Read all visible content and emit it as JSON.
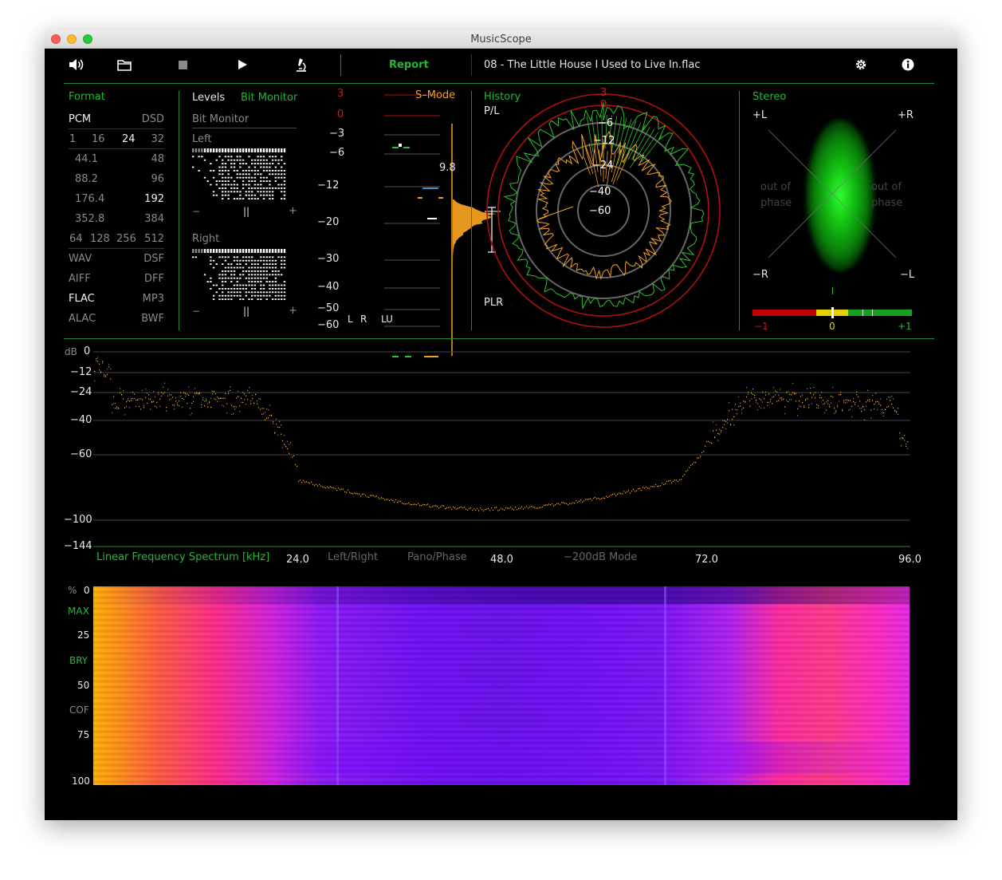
{
  "window": {
    "title": "MusicScope"
  },
  "toolbar": {
    "report_label": "Report",
    "track_title": "08 - The Little House I Used to Live In.flac"
  },
  "format": {
    "label": "Format",
    "rows": [
      [
        "PCM",
        "DSD"
      ],
      [
        "1",
        "16",
        "24",
        "32"
      ],
      [
        "44.1",
        "48"
      ],
      [
        "88.2",
        "96"
      ],
      [
        "176.4",
        "192"
      ],
      [
        "352.8",
        "384"
      ],
      [
        "64",
        "128",
        "256",
        "512"
      ],
      [
        "WAV",
        "DSF"
      ],
      [
        "AIFF",
        "DFF"
      ],
      [
        "FLAC",
        "MP3"
      ],
      [
        "ALAC",
        "BWF"
      ]
    ]
  },
  "levels": {
    "tab_levels": "Levels",
    "tab_bit_monitor": "Bit Monitor",
    "subtitle": "Bit Monitor",
    "left_label": "Left",
    "right_label": "Right",
    "minus": "−",
    "pause": "||",
    "plus": "+",
    "meter_ticks": [
      "3",
      "0",
      "−3",
      "−6",
      "−12",
      "−20",
      "−30",
      "−40",
      "−50",
      "−60"
    ],
    "channels": [
      "L",
      "R",
      "LU"
    ],
    "smode_label": "S–Mode",
    "loudness_value": "9.8"
  },
  "history": {
    "label": "History",
    "pl_label": "P/L",
    "plr_label": "PLR",
    "rings": [
      "3",
      "0",
      "−6",
      "−12",
      "−24",
      "−40",
      "−60"
    ]
  },
  "stereo": {
    "label": "Stereo",
    "plus_l": "+L",
    "plus_r": "+R",
    "minus_r": "−R",
    "minus_l": "−L",
    "out_of": "out of",
    "phase": "phase",
    "corr_min": "−1",
    "corr_mid": "0",
    "corr_max": "+1",
    "colors": {
      "red": "#c00000",
      "yellow": "#e6d100",
      "green": "#1aa020"
    }
  },
  "spectrum": {
    "db_label": "dB",
    "y_ticks": [
      "0",
      "−12",
      "−24",
      "−40",
      "−60",
      "−100",
      "−144"
    ],
    "mode_label": "Linear Frequency Spectrum [kHz]",
    "x_ticks": [
      "24.0",
      "48.0",
      "72.0",
      "96.0"
    ],
    "buttons": [
      "Left/Right",
      "Pano/Phase",
      "−200dB Mode"
    ]
  },
  "spectrogram": {
    "y_unit": "%",
    "ticks": [
      "0",
      "25",
      "50",
      "75",
      "100"
    ],
    "markers": [
      "MAX",
      "BRY",
      "COF"
    ]
  }
}
